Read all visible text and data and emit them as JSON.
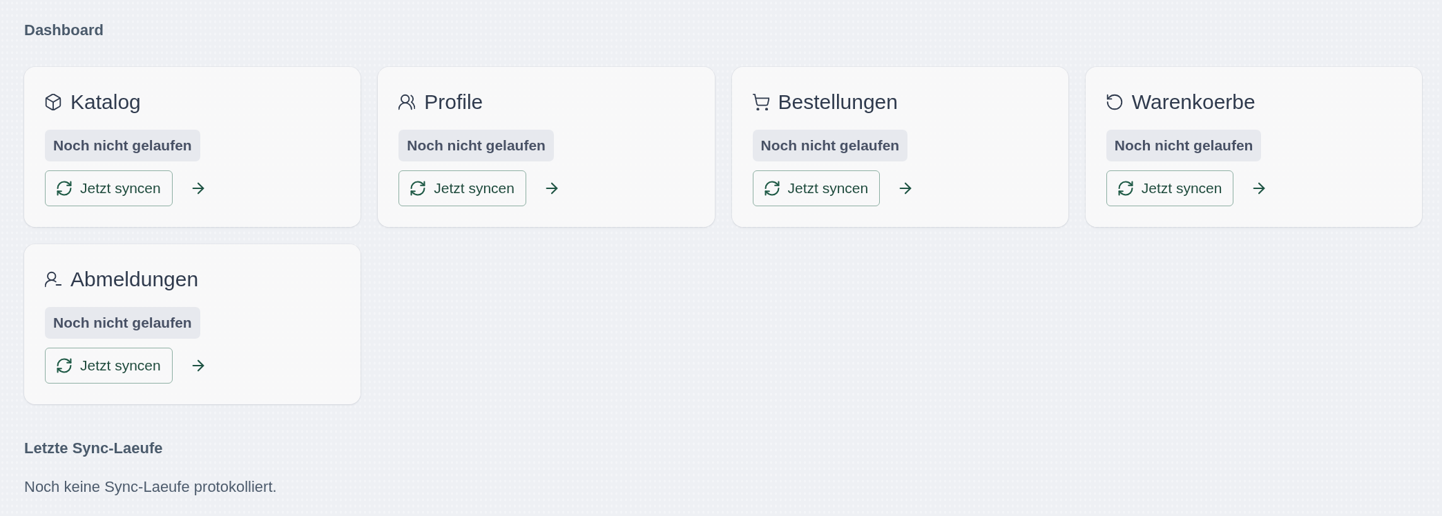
{
  "page": {
    "title": "Dashboard"
  },
  "sync_cards": [
    {
      "kind": "box",
      "title": "Katalog",
      "status": "Noch nicht gelaufen",
      "button": "Jetzt syncen"
    },
    {
      "kind": "users",
      "title": "Profile",
      "status": "Noch nicht gelaufen",
      "button": "Jetzt syncen"
    },
    {
      "kind": "cart",
      "title": "Bestellungen",
      "status": "Noch nicht gelaufen",
      "button": "Jetzt syncen"
    },
    {
      "kind": "undo",
      "title": "Warenkoerbe",
      "status": "Noch nicht gelaufen",
      "button": "Jetzt syncen"
    },
    {
      "kind": "userminus",
      "title": "Abmeldungen",
      "status": "Noch nicht gelaufen",
      "button": "Jetzt syncen"
    }
  ],
  "recent_runs": {
    "title": "Letzte Sync-Laeufe",
    "empty_message": "Noch keine Sync-Laeufe protokolliert."
  }
}
